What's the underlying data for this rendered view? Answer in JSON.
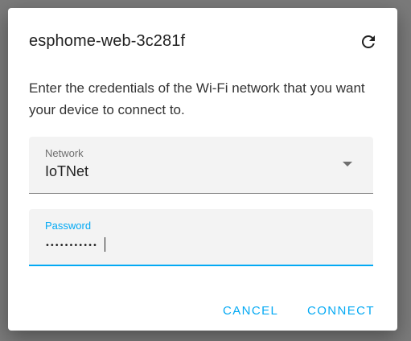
{
  "dialog": {
    "title": "esphome-web-3c281f",
    "refresh_icon": "refresh-icon",
    "description": "Enter the credentials of the Wi-Fi network that you want your device to connect to."
  },
  "network_field": {
    "label": "Network",
    "value": "IoTNet",
    "icon": "dropdown-arrow-icon"
  },
  "password_field": {
    "label": "Password",
    "value": "•••••••••••"
  },
  "actions": {
    "cancel_label": "CANCEL",
    "connect_label": "CONNECT"
  },
  "colors": {
    "accent": "#03a9f4",
    "field_background": "#f3f3f3",
    "backdrop": "#7a7a7a"
  }
}
